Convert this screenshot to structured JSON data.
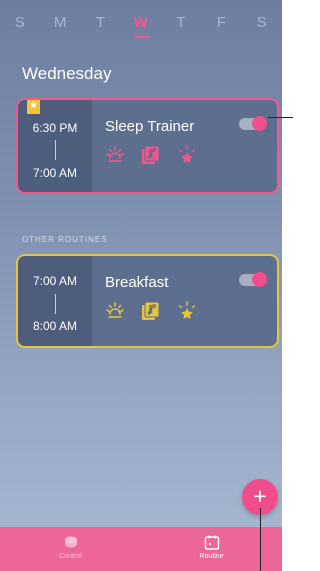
{
  "days": [
    "S",
    "M",
    "T",
    "W",
    "T",
    "F",
    "S"
  ],
  "active_day_index": 3,
  "heading": "Wednesday",
  "favorite_routine": {
    "start": "6:30 PM",
    "end": "7:00 AM",
    "name": "Sleep Trainer",
    "enabled": true,
    "accent": "#ef5b8e",
    "icons": [
      "sun-icon",
      "music-note-icon",
      "sparkle-star-icon"
    ]
  },
  "other_label": "OTHER ROUTINES",
  "other_routine": {
    "start": "7:00 AM",
    "end": "8:00 AM",
    "name": "Breakfast",
    "enabled": true,
    "accent": "#e4c53d",
    "icons": [
      "sun-icon",
      "music-note-icon",
      "sparkle-star-icon"
    ]
  },
  "fab": "+",
  "tabs": [
    {
      "label": "Control",
      "icon": "control-icon",
      "active": false
    },
    {
      "label": "Routine",
      "icon": "calendar-icon",
      "active": true
    }
  ]
}
